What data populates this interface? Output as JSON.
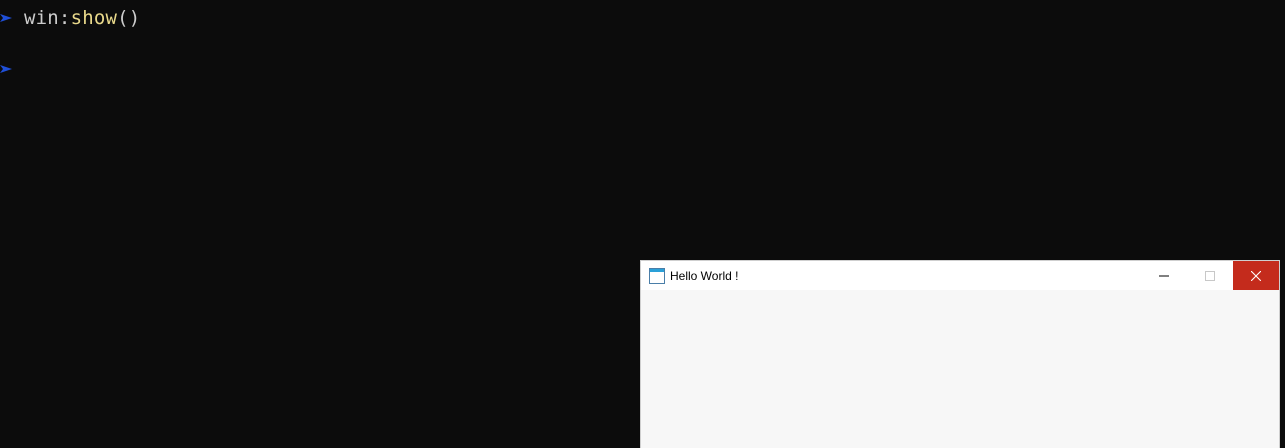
{
  "terminal": {
    "lines": [
      {
        "object": "win",
        "separator": ":",
        "method": "show",
        "parens": "()"
      }
    ],
    "prompt_icon": "triangle-prompt-icon",
    "colors": {
      "background": "#0c0c0c",
      "prompt": "#1f4fd8",
      "text": "#cccccc",
      "function": "#e9d98b"
    }
  },
  "window": {
    "title": "Hello World !",
    "app_icon": "window-app-icon",
    "buttons": {
      "minimize": "minimize-icon",
      "maximize": "maximize-icon",
      "close": "close-icon"
    },
    "colors": {
      "titlebar": "#ffffff",
      "client": "#f7f7f7",
      "close": "#c42b1c"
    }
  }
}
